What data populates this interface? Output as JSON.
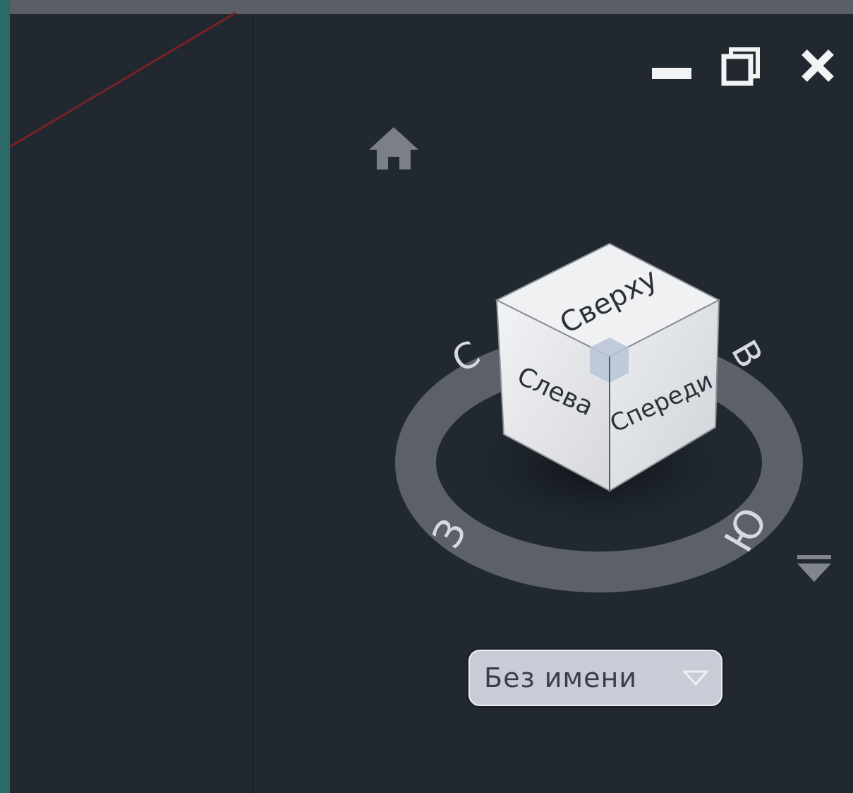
{
  "window_controls": {
    "minimize_icon": "minimize-icon",
    "restore_icon": "restore-icon",
    "close_icon": "close-icon"
  },
  "viewcube": {
    "home_icon": "home-icon",
    "faces": {
      "top": "Сверху",
      "left": "Слева",
      "front": "Спереди"
    },
    "compass": {
      "north": "С",
      "east": "В",
      "south": "Ю",
      "west": "З"
    },
    "menu_icon": "viewcube-menu-icon"
  },
  "named_view": {
    "label": "Без имени",
    "dropdown_icon": "chevron-down-icon"
  },
  "colors": {
    "viewport_bg": "#212830",
    "frame_bg": "#2c6a6a",
    "compass_ring": "#5b6069",
    "cube_face": "#e6e7ea",
    "red_line": "#7a2028"
  }
}
